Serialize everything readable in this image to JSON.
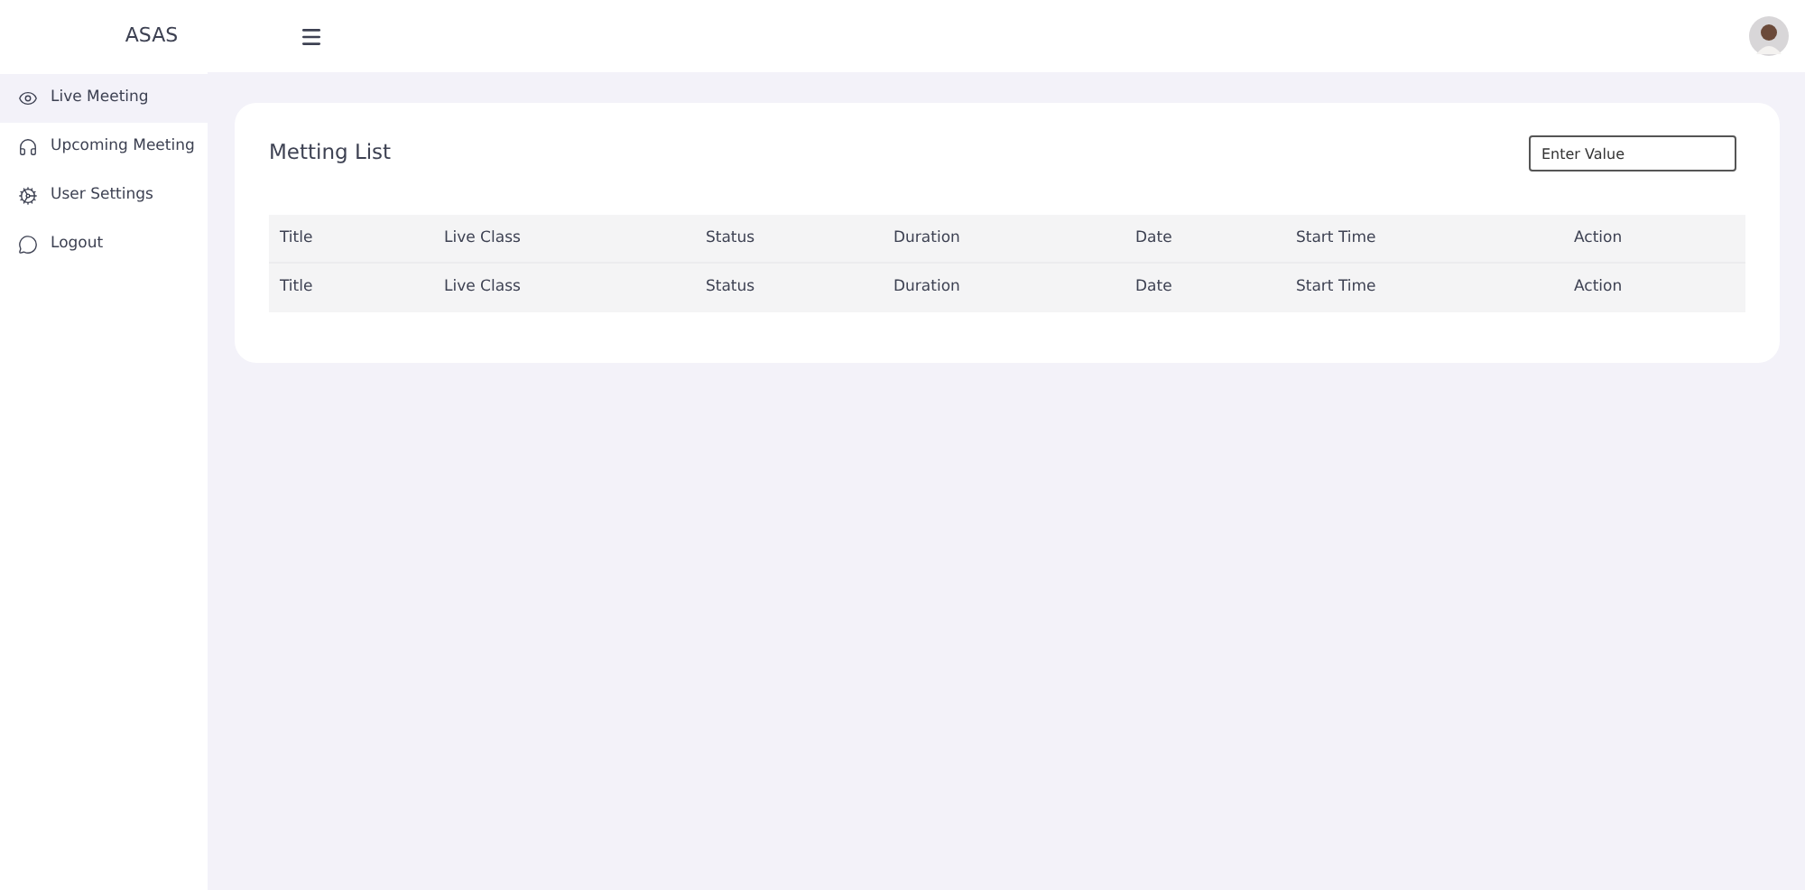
{
  "brand": "ASAS",
  "sidebar": {
    "items": [
      {
        "label": "Live Meeting",
        "selected": true
      },
      {
        "label": "Upcoming Meeting",
        "selected": false
      },
      {
        "label": "User Settings",
        "selected": false
      },
      {
        "label": "Logout",
        "selected": false
      }
    ]
  },
  "card": {
    "title": "Metting List",
    "search": {
      "placeholder": "Enter Value"
    },
    "table": {
      "columns": [
        "Title",
        "Live Class",
        "Status",
        "Duration",
        "Date",
        "Start Time",
        "Action"
      ],
      "rows": [
        [
          "Title",
          "Live Class",
          "Status",
          "Duration",
          "Date",
          "Start Time",
          "Action"
        ]
      ]
    }
  }
}
